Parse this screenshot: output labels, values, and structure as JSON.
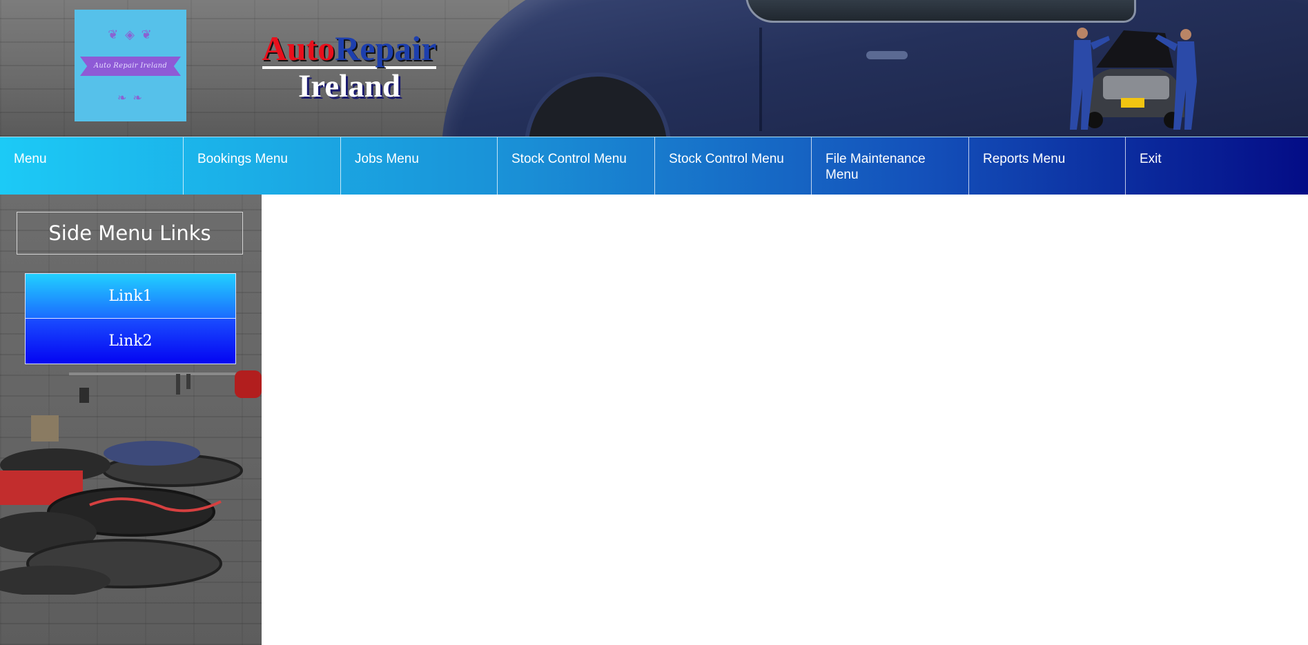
{
  "header": {
    "logo_text": "Auto Repair Ireland",
    "brand_part1": "Auto",
    "brand_part2": "Repair",
    "brand_line2": "Ireland"
  },
  "nav": {
    "items": [
      {
        "label": "Menu"
      },
      {
        "label": "Bookings Menu"
      },
      {
        "label": "Jobs Menu"
      },
      {
        "label": "Stock Control Menu"
      },
      {
        "label": "Stock Control Menu"
      },
      {
        "label": "File Maintenance Menu"
      },
      {
        "label": "Reports Menu"
      },
      {
        "label": "Exit"
      }
    ]
  },
  "sidebar": {
    "title": "Side Menu Links",
    "links": [
      {
        "label": "Link1"
      },
      {
        "label": "Link2"
      }
    ]
  },
  "colors": {
    "nav_start": "#1ccaf6",
    "nav_end": "#040c86",
    "brand_red": "#e8101c",
    "brand_blue": "#1d3fae",
    "logo_bg": "#56c1ea",
    "link1": "#22d0ff",
    "link2": "#0404f2"
  }
}
